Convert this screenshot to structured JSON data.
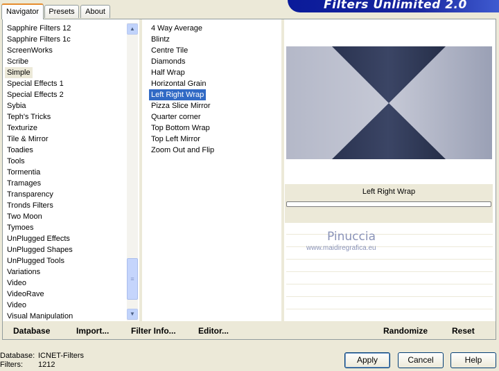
{
  "app": {
    "title": "Filters Unlimited 2.0"
  },
  "tabs": [
    {
      "label": "Navigator"
    },
    {
      "label": "Presets"
    },
    {
      "label": "About"
    }
  ],
  "categories": [
    "Sapphire Filters 12",
    "Sapphire Filters 1c",
    "ScreenWorks",
    "Scribe",
    "Simple",
    "Special Effects 1",
    "Special Effects 2",
    "Sybia",
    "Teph's Tricks",
    "Texturize",
    "Tile & Mirror",
    "Toadies",
    "Tools",
    "Tormentia",
    "Tramages",
    "Transparency",
    "Tronds Filters",
    "Two Moon",
    "Tymoes",
    "UnPlugged Effects",
    "UnPlugged Shapes",
    "UnPlugged Tools",
    "Variations",
    "Video",
    "VideoRave",
    "Video",
    "Visual Manipulation"
  ],
  "selected_category": "Simple",
  "filters": [
    "4 Way Average",
    "Blintz",
    "Centre Tile",
    "Diamonds",
    "Half Wrap",
    "Horizontal Grain",
    "Left Right Wrap",
    "Pizza Slice Mirror",
    "Quarter corner",
    "Top Bottom Wrap",
    "Top Left Mirror",
    "Zoom Out and Flip"
  ],
  "selected_filter": "Left Right Wrap",
  "preview": {
    "filter_name": "Left Right Wrap",
    "watermark_name": "Pinuccia",
    "watermark_url": "www.maidiregrafica.eu"
  },
  "toolbar": {
    "database": "Database",
    "import": "Import...",
    "filter_info": "Filter Info...",
    "editor": "Editor...",
    "randomize": "Randomize",
    "reset": "Reset"
  },
  "status": {
    "database_label": "Database:",
    "database_value": "ICNET-Filters",
    "filters_label": "Filters:",
    "filters_value": "1212"
  },
  "buttons": {
    "apply": "Apply",
    "cancel": "Cancel",
    "help": "Help"
  },
  "colors": {
    "selection": "#316ac5",
    "banner": "#18269e",
    "preview_dark": "#2c3550",
    "preview_light": "#b4b8c8"
  }
}
